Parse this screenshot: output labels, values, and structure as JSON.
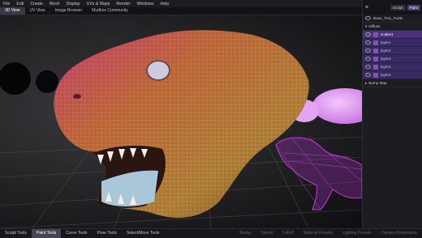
{
  "menu": {
    "items": [
      "File",
      "Edit",
      "Create",
      "Mesh",
      "Display",
      "UVs & Maps",
      "Render",
      "Windows",
      "Help"
    ]
  },
  "tabs": {
    "items": [
      "3D View",
      "UV View",
      "Image Browser",
      "Mudbox Community"
    ],
    "active": 0
  },
  "right_panel": {
    "tabs": [
      "Sculpt",
      "Paint"
    ],
    "active_tab": 1,
    "layers": [
      {
        "label": "Base_Trex_Turtle"
      },
      {
        "label": "Diffuse"
      },
      {
        "label": "scales1"
      },
      {
        "label": "layer1"
      },
      {
        "label": "layer2"
      },
      {
        "label": "layer3"
      },
      {
        "label": "layer4"
      },
      {
        "label": "layer5"
      },
      {
        "label": "Bump Map"
      }
    ]
  },
  "bottom": {
    "tools": [
      "Sculpt Tools",
      "Paint Tools",
      "Curve Tools",
      "Pose Tools",
      "Select/Move Tools"
    ],
    "active": 1,
    "extra": [
      "Stamp",
      "Stencil",
      "Falloff",
      "Material Presets",
      "Lighting Presets",
      "Camera Bookmarks"
    ]
  },
  "colors": {
    "accent": "#6b3fb0",
    "selection": "#4b3278",
    "wireframe": "#c23bd6"
  }
}
